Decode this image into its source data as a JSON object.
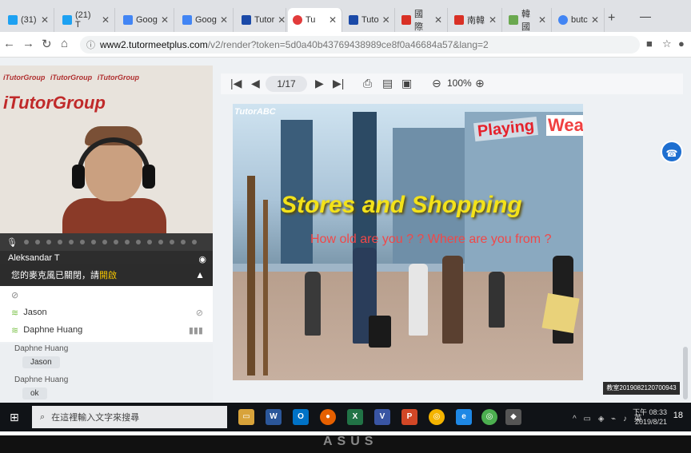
{
  "browser": {
    "tabs": [
      {
        "label": "(31) ",
        "color": "#1da1f2"
      },
      {
        "label": "(21) T",
        "color": "#1da1f2"
      },
      {
        "label": "Goog",
        "color": "#4285f4"
      },
      {
        "label": "Goog",
        "color": "#4285f4"
      },
      {
        "label": "Tutor",
        "color": "#1b4aa8"
      },
      {
        "label": "Tu",
        "color": "#e23b3b"
      },
      {
        "label": "Tuto",
        "color": "#1b4aa8"
      },
      {
        "label": "國際",
        "color": "#d93025"
      },
      {
        "label": "南韓",
        "color": "#d93025"
      },
      {
        "label": "韓國",
        "color": "#6aa84f"
      },
      {
        "label": "butc",
        "color": "#4285f4"
      }
    ],
    "url_host": "www2.tutormeetplus.com",
    "url_path": "/v2/render?token=5d0a40b43769438989ce8f0a46684a57&lang=2"
  },
  "video": {
    "wall_text": "iTutorGroup",
    "participant_name": "Aleksandar T"
  },
  "chat": {
    "notice_prefix": "您的麥克風已關閉，請",
    "notice_action": "開啟",
    "roster": [
      {
        "name": "Jason"
      },
      {
        "name": "Daphne Huang"
      }
    ],
    "messages": [
      {
        "sender": "Daphne Huang",
        "text": "Jason"
      },
      {
        "sender": "Daphne Huang",
        "text": "ok"
      }
    ]
  },
  "slide_toolbar": {
    "page": "1/17",
    "zoom": "100%"
  },
  "slide": {
    "brand": "TutorABC",
    "title": "Stores and Shopping",
    "subtitle": "How old are you ? ? Where are you from ?",
    "signs": [
      "Playing",
      "Wear"
    ]
  },
  "classroom_id": "教室2019082120700943",
  "taskbar": {
    "search_placeholder": "在這裡輸入文字來搜尋",
    "time": "下午 08:33",
    "date": "2019/8/21",
    "notifications": "18"
  }
}
